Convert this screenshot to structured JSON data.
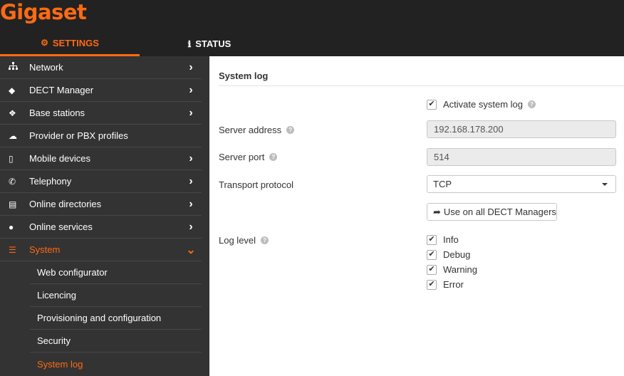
{
  "app": {
    "logo": "Gigaset"
  },
  "tabs": [
    {
      "label": "SETTINGS",
      "icon": "gears-icon",
      "active": true
    },
    {
      "label": "STATUS",
      "icon": "info-icon",
      "active": false
    }
  ],
  "sidebar": {
    "items": [
      {
        "label": "Network",
        "icon": "network-icon",
        "chevron": "right"
      },
      {
        "label": "DECT Manager",
        "icon": "cube-icon",
        "chevron": "right"
      },
      {
        "label": "Base stations",
        "icon": "cubes-icon",
        "chevron": "right"
      },
      {
        "label": "Provider or PBX profiles",
        "icon": "cloud-icon",
        "chevron": ""
      },
      {
        "label": "Mobile devices",
        "icon": "mobile-icon",
        "chevron": "right"
      },
      {
        "label": "Telephony",
        "icon": "phone-icon",
        "chevron": "right"
      },
      {
        "label": "Online directories",
        "icon": "book-icon",
        "chevron": "right"
      },
      {
        "label": "Online services",
        "icon": "globe-icon",
        "chevron": "right"
      },
      {
        "label": "System",
        "icon": "sliders-icon",
        "chevron": "down",
        "active": true
      }
    ],
    "sub_items": [
      {
        "label": "Web configurator"
      },
      {
        "label": "Licencing"
      },
      {
        "label": "Provisioning and configuration"
      },
      {
        "label": "Security"
      },
      {
        "label": "System log",
        "active": true
      }
    ]
  },
  "main": {
    "title": "System log",
    "activate_label": "Activate system log",
    "activate_checked": true,
    "server_address_label": "Server address",
    "server_address_value": "192.168.178.200",
    "server_port_label": "Server port",
    "server_port_value": "514",
    "transport_label": "Transport protocol",
    "transport_value": "TCP",
    "use_all_button": "Use on all DECT Managers",
    "log_level_label": "Log level",
    "log_levels": [
      {
        "label": "Info",
        "checked": true
      },
      {
        "label": "Debug",
        "checked": true
      },
      {
        "label": "Warning",
        "checked": true
      },
      {
        "label": "Error",
        "checked": true
      }
    ]
  },
  "colors": {
    "accent": "#ff6a13",
    "header_bg": "#222222",
    "sidebar_bg": "#333333"
  }
}
